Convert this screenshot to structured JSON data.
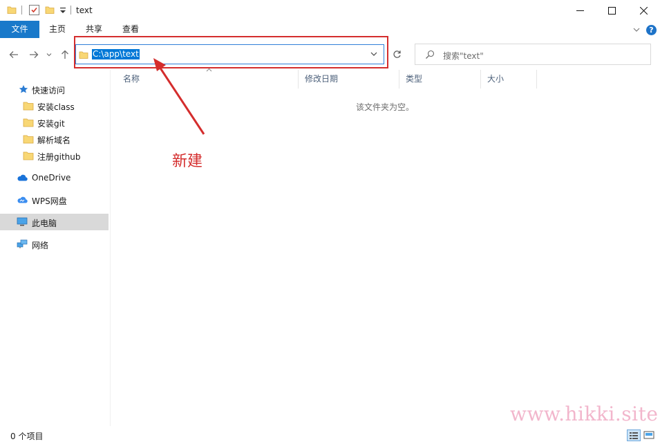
{
  "window": {
    "title": "text"
  },
  "ribbon": {
    "tabs": [
      "文件",
      "主页",
      "共享",
      "查看"
    ],
    "help_label": "?"
  },
  "nav": {
    "address_value": "C:\\app\\text",
    "search_placeholder": "搜索\"text\""
  },
  "sidebar": {
    "quick_access": "快速访问",
    "pinned": [
      "安装class",
      "安装git",
      "解析域名",
      "注册github"
    ],
    "onedrive": "OneDrive",
    "wps": "WPS网盘",
    "this_pc": "此电脑",
    "network": "网络"
  },
  "columns": [
    "名称",
    "修改日期",
    "类型",
    "大小"
  ],
  "content": {
    "empty_message": "该文件夹为空。"
  },
  "annotation": {
    "label": "新建"
  },
  "status": {
    "item_count": "0 个项目"
  },
  "watermark": "www.hikki.site",
  "colors": {
    "accent": "#1979ca",
    "annotation_red": "#d42d2d",
    "selected_bg": "#d9d9d9",
    "folder_yellow": "#f8d775"
  },
  "icons": {
    "quick_access": "pin-star-icon",
    "onedrive": "cloud-icon",
    "wps": "wps-cloud-icon",
    "this_pc": "computer-icon",
    "network": "network-icon"
  }
}
